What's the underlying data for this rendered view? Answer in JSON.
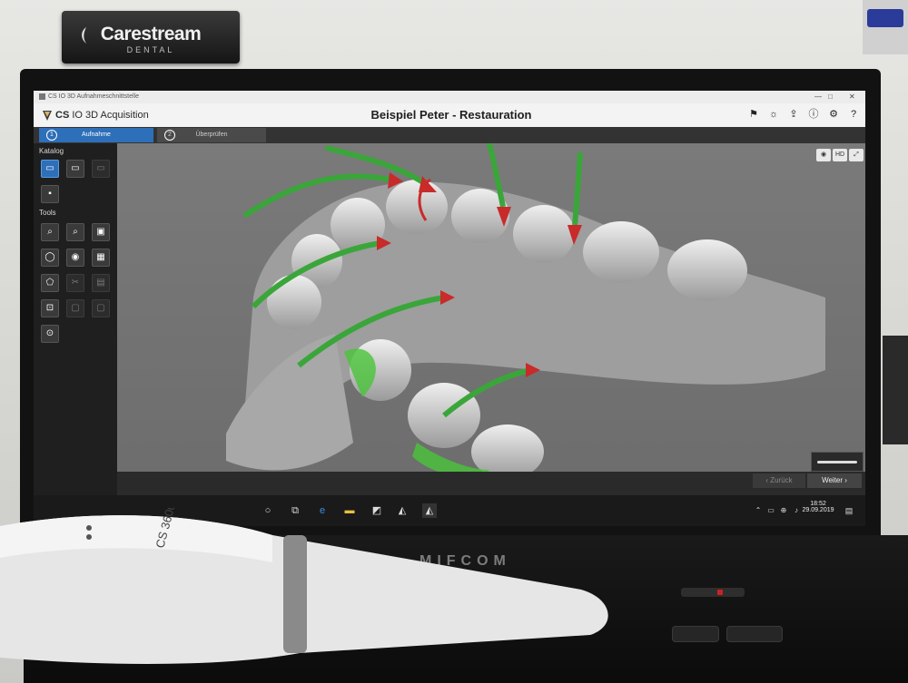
{
  "branding": {
    "name": "Carestream",
    "sub": "DENTAL"
  },
  "window": {
    "small_title": "CS IO 3D Aufnahmeschnittstelle",
    "app_name_bold": "CS",
    "app_name_rest": " IO 3D Acquisition",
    "document_title": "Beispiel Peter - Restauration"
  },
  "steps": [
    {
      "num": "1",
      "label": "Aufnahme"
    },
    {
      "num": "2",
      "label": "Überprüfen"
    }
  ],
  "sidebar": {
    "catalog_heading": "Katalog",
    "tools_heading": "Tools"
  },
  "navigation": {
    "back_label": "Zurück",
    "next_label": "Weiter"
  },
  "taskbar": {
    "time": "18:52",
    "date": "29.09.2019"
  },
  "laptop_brand": "MIFCOM",
  "scanner_label": "CS 3600",
  "colors": {
    "active_step": "#2d6fb8",
    "arrow_shaft": "#3aa63a",
    "arrow_head": "#c92a2a"
  }
}
